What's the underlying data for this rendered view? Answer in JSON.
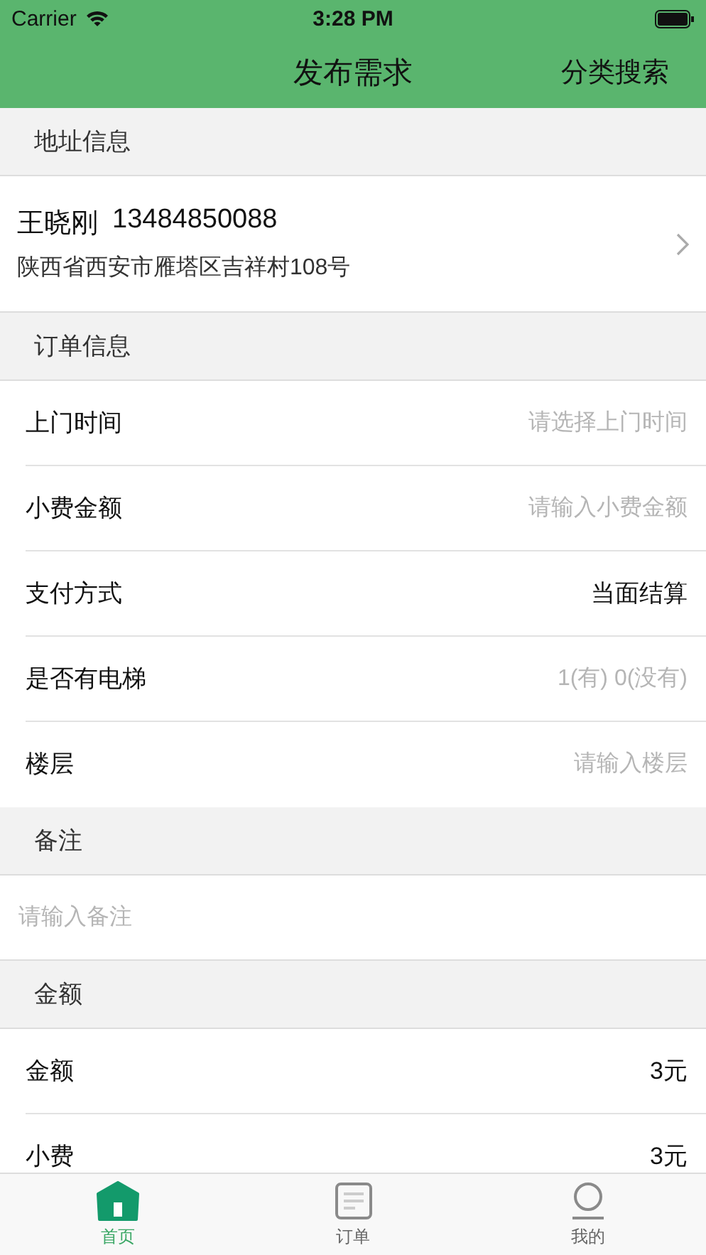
{
  "status_bar": {
    "carrier": "Carrier",
    "time": "3:28 PM"
  },
  "nav_bar": {
    "title": "发布需求",
    "right_button": "分类搜索"
  },
  "sections": [
    {
      "kind": "address",
      "header": "地址信息",
      "name": "王晓刚",
      "phone": "13484850088",
      "address": "陕西省西安市雁塔区吉祥村108号"
    },
    {
      "kind": "form",
      "header": "订单信息",
      "rows": [
        {
          "label": "上门时间",
          "placeholder": "请选择上门时间"
        },
        {
          "label": "小费金额",
          "placeholder": "请输入小费金额"
        },
        {
          "label": "支付方式",
          "value": "当面结算"
        },
        {
          "label": "是否有电梯",
          "placeholder": "1(有) 0(没有)"
        },
        {
          "label": "楼层",
          "placeholder": "请输入楼层"
        }
      ]
    },
    {
      "kind": "note",
      "header": "备注",
      "placeholder": "请输入备注"
    },
    {
      "kind": "form",
      "header": "金额",
      "rows": [
        {
          "label": "金额",
          "value": "3元"
        },
        {
          "label": "小费",
          "value": "3元"
        }
      ]
    }
  ],
  "tab_bar": [
    {
      "label": "首页",
      "kind": "home",
      "selected": true
    },
    {
      "label": "订单",
      "kind": "list",
      "selected": false
    },
    {
      "label": "我的",
      "kind": "user",
      "selected": false
    }
  ]
}
